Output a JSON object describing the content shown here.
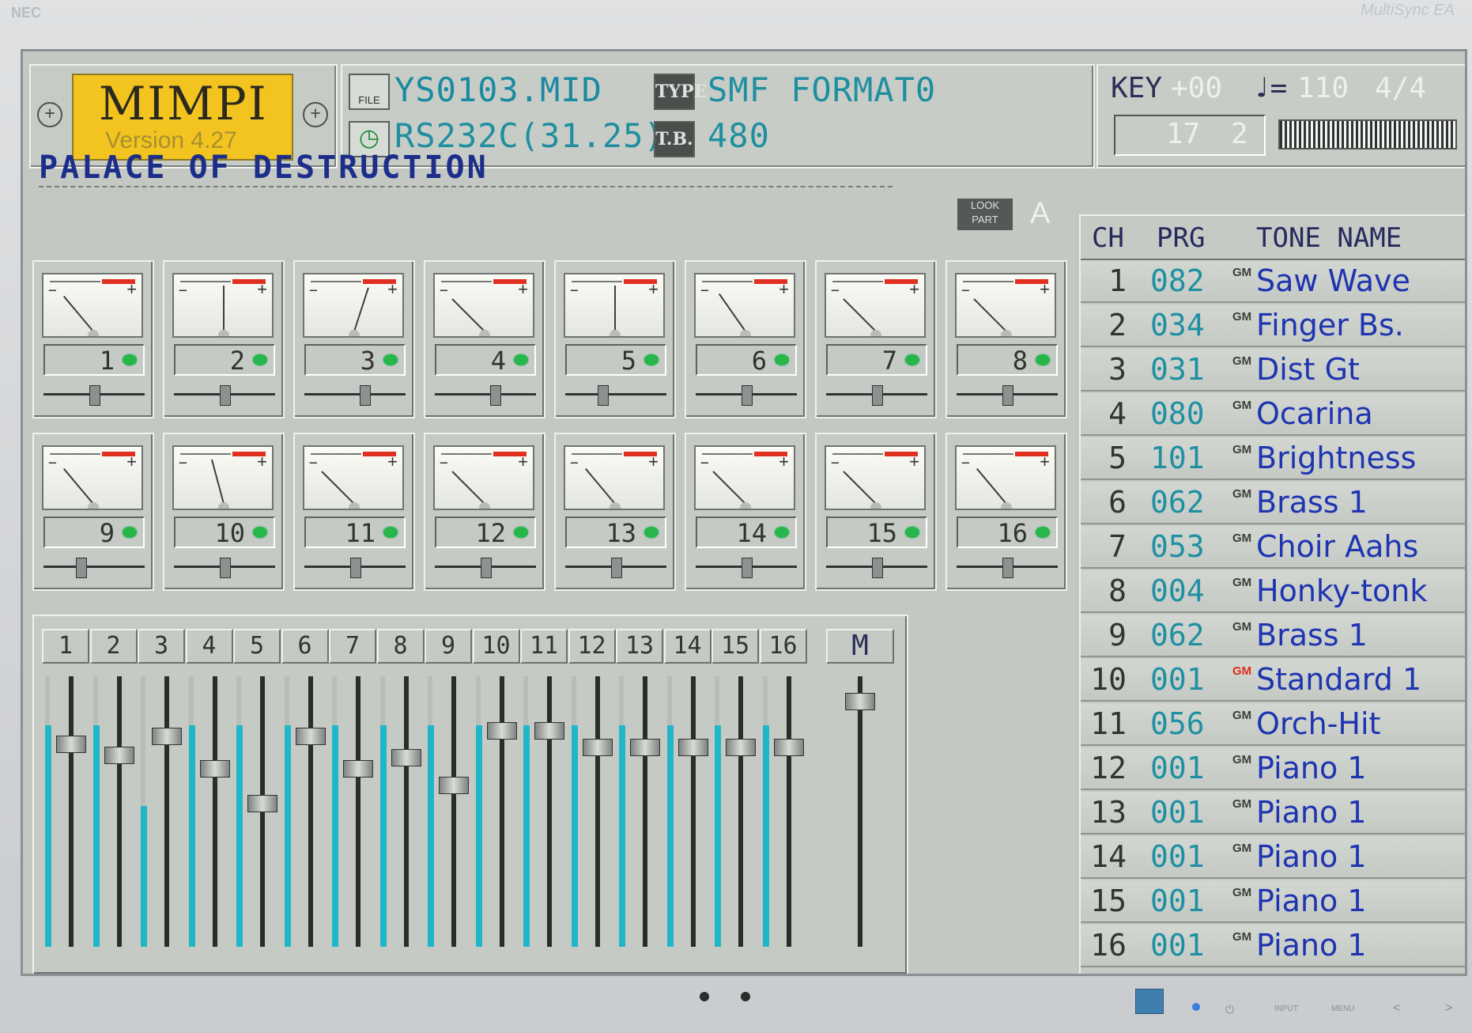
{
  "monitor": {
    "brand": "NEC",
    "model": "MultiSync EA"
  },
  "app": {
    "name": "MIMPI",
    "version": "Version 4.27"
  },
  "file": {
    "name": "YS0103.MID",
    "name_icon_label": "FILE",
    "port": "RS232C(31.25)",
    "type_icon_label": "TYPE",
    "type_value": "SMF FORMAT0",
    "tb_icon_label": "T.B.",
    "tb_value": "480"
  },
  "transport": {
    "key_label": "KEY",
    "key_value": "+00",
    "tempo_symbol": "♩=",
    "tempo_value": "110",
    "time_sig": "4/4",
    "measure": "17",
    "beat": "2"
  },
  "song": {
    "title": "PALACE OF DESTRUCTION"
  },
  "lookpart": {
    "label": "LOOK PART",
    "value": "A"
  },
  "parts": [
    {
      "num": "1",
      "needle": -40,
      "pan": 0.5
    },
    {
      "num": "2",
      "needle": 0,
      "pan": 0.5
    },
    {
      "num": "3",
      "needle": 18,
      "pan": 0.6
    },
    {
      "num": "4",
      "needle": -45,
      "pan": 0.6
    },
    {
      "num": "5",
      "needle": 0,
      "pan": 0.35
    },
    {
      "num": "6",
      "needle": -35,
      "pan": 0.5
    },
    {
      "num": "7",
      "needle": -45,
      "pan": 0.5
    },
    {
      "num": "8",
      "needle": -45,
      "pan": 0.5
    },
    {
      "num": "9",
      "needle": -40,
      "pan": 0.35
    },
    {
      "num": "10",
      "needle": -15,
      "pan": 0.5
    },
    {
      "num": "11",
      "needle": -45,
      "pan": 0.5
    },
    {
      "num": "12",
      "needle": -45,
      "pan": 0.5
    },
    {
      "num": "13",
      "needle": -40,
      "pan": 0.5
    },
    {
      "num": "14",
      "needle": -45,
      "pan": 0.5
    },
    {
      "num": "15",
      "needle": -45,
      "pan": 0.5
    },
    {
      "num": "16",
      "needle": -40,
      "pan": 0.5
    }
  ],
  "faders": [
    {
      "label": "1",
      "level": 0.82,
      "pos": 0.22
    },
    {
      "label": "2",
      "level": 0.82,
      "pos": 0.26
    },
    {
      "label": "3",
      "level": 0.52,
      "pos": 0.19
    },
    {
      "label": "4",
      "level": 0.82,
      "pos": 0.31
    },
    {
      "label": "5",
      "level": 0.82,
      "pos": 0.44
    },
    {
      "label": "6",
      "level": 0.82,
      "pos": 0.19
    },
    {
      "label": "7",
      "level": 0.82,
      "pos": 0.31
    },
    {
      "label": "8",
      "level": 0.82,
      "pos": 0.27
    },
    {
      "label": "9",
      "level": 0.82,
      "pos": 0.37
    },
    {
      "label": "10",
      "level": 0.82,
      "pos": 0.17
    },
    {
      "label": "11",
      "level": 0.82,
      "pos": 0.17
    },
    {
      "label": "12",
      "level": 0.82,
      "pos": 0.23
    },
    {
      "label": "13",
      "level": 0.82,
      "pos": 0.23
    },
    {
      "label": "14",
      "level": 0.82,
      "pos": 0.23
    },
    {
      "label": "15",
      "level": 0.82,
      "pos": 0.23
    },
    {
      "label": "16",
      "level": 0.82,
      "pos": 0.23
    }
  ],
  "master": {
    "label": "M",
    "pos": 0.06
  },
  "channel_table": {
    "headers": {
      "ch": "CH",
      "prg": "PRG",
      "tone": "TONE NAME"
    },
    "rows": [
      {
        "ch": "1",
        "prg": "082",
        "gm": "GM",
        "name": "Saw Wave"
      },
      {
        "ch": "2",
        "prg": "034",
        "gm": "GM",
        "name": "Finger Bs."
      },
      {
        "ch": "3",
        "prg": "031",
        "gm": "GM",
        "name": "Dist Gt"
      },
      {
        "ch": "4",
        "prg": "080",
        "gm": "GM",
        "name": "Ocarina"
      },
      {
        "ch": "5",
        "prg": "101",
        "gm": "GM",
        "name": "Brightness"
      },
      {
        "ch": "6",
        "prg": "062",
        "gm": "GM",
        "name": "Brass 1"
      },
      {
        "ch": "7",
        "prg": "053",
        "gm": "GM",
        "name": "Choir Aahs"
      },
      {
        "ch": "8",
        "prg": "004",
        "gm": "GM",
        "name": "Honky-tonk"
      },
      {
        "ch": "9",
        "prg": "062",
        "gm": "GM",
        "name": "Brass 1"
      },
      {
        "ch": "10",
        "prg": "001",
        "gm": "GM",
        "name": "Standard 1",
        "drum": true
      },
      {
        "ch": "11",
        "prg": "056",
        "gm": "GM",
        "name": "Orch-Hit"
      },
      {
        "ch": "12",
        "prg": "001",
        "gm": "GM",
        "name": "Piano 1"
      },
      {
        "ch": "13",
        "prg": "001",
        "gm": "GM",
        "name": "Piano 1"
      },
      {
        "ch": "14",
        "prg": "001",
        "gm": "GM",
        "name": "Piano 1"
      },
      {
        "ch": "15",
        "prg": "001",
        "gm": "GM",
        "name": "Piano 1"
      },
      {
        "ch": "16",
        "prg": "001",
        "gm": "GM",
        "name": "Piano 1"
      }
    ]
  },
  "monitor_buttons": {
    "input": "INPUT",
    "menu": "MENU",
    "prev": "<",
    "next": ">"
  },
  "colors": {
    "accent": "#1f8fa0",
    "tone_name": "#1e34b0",
    "logo": "#f3c41f",
    "level": "#1fb7c8",
    "led": "#27b64a"
  }
}
